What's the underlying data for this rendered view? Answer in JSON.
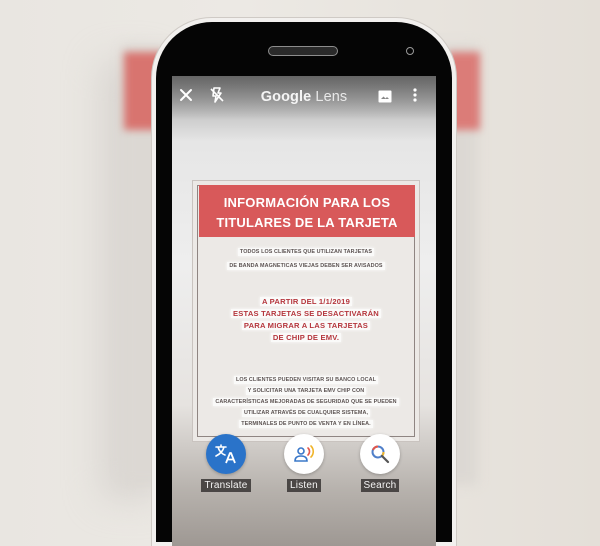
{
  "app": {
    "title_brand": "Google",
    "title_product": "Lens"
  },
  "toolbar": {
    "close_icon": "close-icon",
    "flash_icon": "flash-off-icon",
    "gallery_icon": "gallery-icon",
    "more_icon": "more-vert-icon"
  },
  "document": {
    "banner_lines": [
      "INFORMACIÓN PARA LOS",
      "TITULARES DE LA TARJETA"
    ],
    "intro_lines": [
      "TODOS LOS CLIENTES QUE UTILIZAN TARJETAS",
      "DE BANDA MAGNETICAS VIEJAS DEBEN SER AVISADOS"
    ],
    "notice_lines": [
      "A PARTIR DEL 1/1/2019",
      "ESTAS TARJETAS SE DESACTIVARÁN",
      "PARA MIGRAR A LAS TARJETAS",
      "DE CHIP DE EMV."
    ],
    "body_lines": [
      "LOS CLIENTES PUEDEN VISITAR SU BANCO LOCAL",
      "Y SOLICITAR UNA TARJETA EMV CHIP CON",
      "CARACTERÍSTICAS MEJORADAS DE SEGURIDAD  QUE SE PUEDEN",
      "UTILIZAR ATRAVÉS DE CUALQUIER SISTEMA,",
      "TERMINALES DE PUNTO DE VENTA Y EN LÍNEA."
    ]
  },
  "actions": [
    {
      "label": "Translate",
      "icon": "translate-icon",
      "active": true
    },
    {
      "label": "Listen",
      "icon": "listen-icon",
      "active": false
    },
    {
      "label": "Search",
      "icon": "search-icon",
      "active": false
    }
  ],
  "colors": {
    "accent_blue": "#2a73c9",
    "banner_red": "#d8595a",
    "notice_red": "#b5363d"
  }
}
